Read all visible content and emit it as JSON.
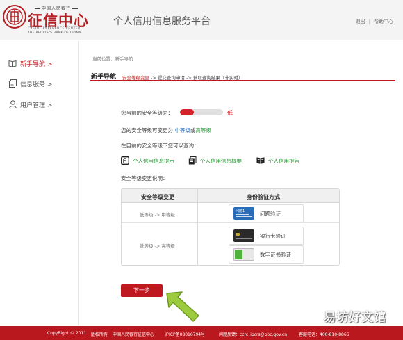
{
  "header": {
    "logo_top": "中国人民银行",
    "logo_main": "征信中心",
    "logo_en_line1": "CREDIT REFERENCE CENTER",
    "logo_en_line2": "THE PEOPLE'S BANK OF CHINA",
    "title": "个人信用信息服务平台",
    "logout": "退出",
    "help": "帮助中心",
    "separator": "|"
  },
  "sidebar": {
    "items": [
      {
        "label": "新手导航 >",
        "icon": "book-icon",
        "active": true
      },
      {
        "label": "信息服务 >",
        "icon": "document-icon",
        "active": false
      },
      {
        "label": "用户管理 >",
        "icon": "user-icon",
        "active": false
      }
    ]
  },
  "breadcrumb": "当前位置：新手导航",
  "section": {
    "title": "新手导航",
    "step1": "安全等级变更",
    "step2": " -> 提交查询申请 -> 获取查询结果（非实时）"
  },
  "content": {
    "current_level_label": "您当前的安全等级为：",
    "current_level_value": "低",
    "current_level_fraction": 0.33,
    "change_prefix": "您的安全等级可变更为",
    "mid_level": "中等级",
    "or": "或",
    "high_level": "高等级",
    "query_intro": "在目前的安全等级下您可以查询：",
    "query_items": [
      {
        "label": "个人信用信息提示",
        "icon": "doc-f-icon"
      },
      {
        "label": "个人信用信息概要",
        "icon": "doc-list-icon"
      },
      {
        "label": "个人信用报告",
        "icon": "open-book-icon"
      }
    ],
    "change_desc": "安全等级变更说明："
  },
  "table": {
    "headers": [
      "安全等级变更",
      "身份验证方式"
    ],
    "rows": [
      {
        "change": "低等级 -> 中等级",
        "methods": [
          {
            "label": "问题验证",
            "card": "question-card-icon"
          }
        ]
      },
      {
        "change": "低等级 -> 高等级",
        "methods": [
          {
            "label": "银行卡验证",
            "card": "bank-card-icon"
          },
          {
            "label": "数字证书验证",
            "card": "digital-cert-icon"
          }
        ]
      }
    ],
    "question_card_text": "问题1"
  },
  "next_button": "下一步",
  "footer": {
    "copyright": "CopyRight © 2011",
    "rights": "版权所有",
    "org": "中国人民银行征信中心",
    "icp": "沪ICP备08016794号",
    "feedback": "问题反馈：ccrc_ipcrs@pbc.gov.cn",
    "hotline": "客服电话：400-810-8866"
  },
  "watermark": "易坊好文馆",
  "colors": {
    "brand_red": "#c0181f",
    "link_green": "#2a9a3a",
    "link_blue": "#1f66b3"
  }
}
